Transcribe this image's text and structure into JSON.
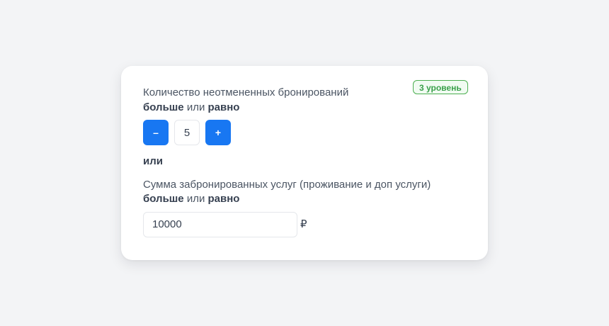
{
  "level_badge": "3 уровень",
  "condition1": {
    "label": "Количество неотмененных бронирований",
    "op_more": "больше",
    "op_or": "или",
    "op_equal": "равно",
    "decrement_label": "–",
    "value": "5",
    "increment_label": "+"
  },
  "or_separator": "или",
  "condition2": {
    "label": "Сумма забронированных услуг (проживание и доп услуги)",
    "op_more": "больше",
    "op_or": "или",
    "op_equal": "равно",
    "value": "10000",
    "currency": "₽"
  },
  "colors": {
    "accent": "#1877f2",
    "badge_green": "#3aa04a"
  }
}
